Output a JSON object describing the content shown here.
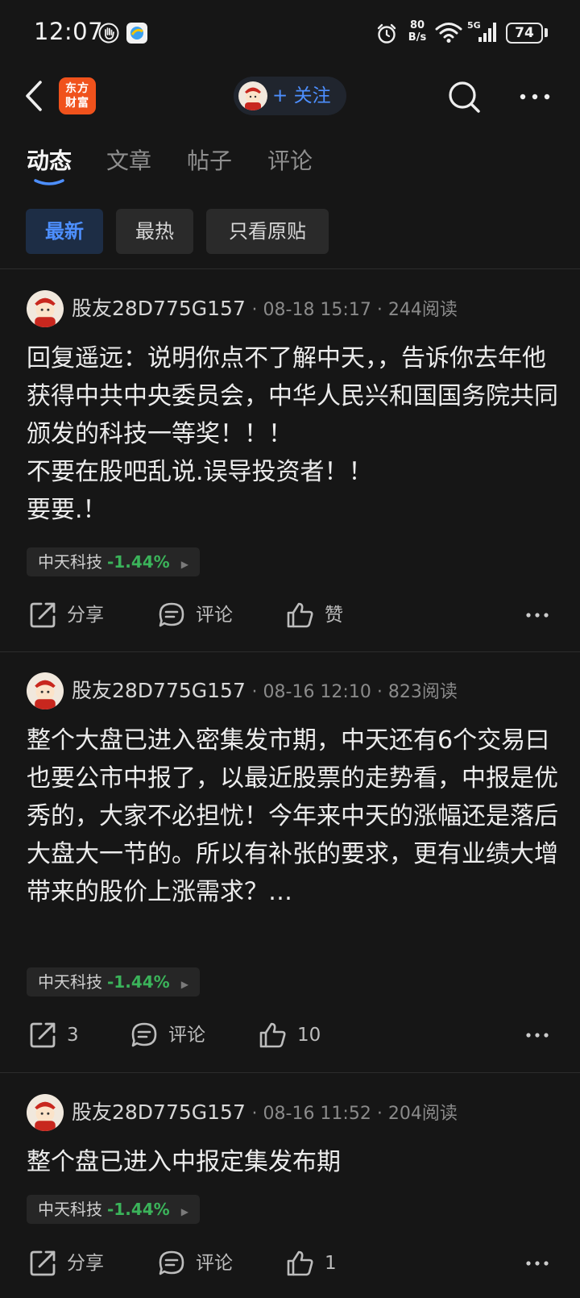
{
  "status_bar": {
    "time": "12:07",
    "net_speed_value": "80",
    "net_speed_unit": "B/s",
    "network": "5G",
    "battery": "74"
  },
  "header": {
    "brand_line1": "东方",
    "brand_line2": "财富",
    "follow_label": "+ 关注"
  },
  "tabs": [
    {
      "label": "动态",
      "active": true
    },
    {
      "label": "文章",
      "active": false
    },
    {
      "label": "帖子",
      "active": false
    },
    {
      "label": "评论",
      "active": false
    }
  ],
  "filters": [
    {
      "label": "最新",
      "active": true
    },
    {
      "label": "最热",
      "active": false
    },
    {
      "label": "只看原贴",
      "active": false
    }
  ],
  "posts": [
    {
      "user": "股友28D775G157",
      "time": "08-18 15:17",
      "reads": "244阅读",
      "body": "回复遥远：说明你点不了解中天，，告诉你去年他获得中共中央委员会，中华人民兴和国国务院共同颁发的科技一等奖！！！\n不要在股吧乱说.误导投资者！！\n要要.！",
      "stock_name": "中天科技",
      "stock_change": "-1.44%",
      "share": "分享",
      "comment": "评论",
      "like": "赞"
    },
    {
      "user": "股友28D775G157",
      "time": "08-16 12:10",
      "reads": "823阅读",
      "body": "整个大盘已进入密集发市期，中天还有6个交易曰也要公市中报了，以最近股票的走势看，中报是优秀的，大家不必担忧！今年来中天的涨幅还是落后大盘大一节的。所以有补张的要求，更有业绩大增带来的股价上涨需求？…",
      "stock_name": "中天科技",
      "stock_change": "-1.44%",
      "share": "3",
      "comment": "评论",
      "like": "10"
    },
    {
      "user": "股友28D775G157",
      "time": "08-16 11:52",
      "reads": "204阅读",
      "body": "整个盘已进入中报定集发布期",
      "stock_name": "中天科技",
      "stock_change": "-1.44%",
      "share": "分享",
      "comment": "评论",
      "like": "1"
    }
  ],
  "separator": "·",
  "colors": {
    "background": "#161616",
    "accent_blue": "#4d8fff",
    "brand_orange": "#f0521c",
    "stock_down_green": "#3bb35a"
  }
}
